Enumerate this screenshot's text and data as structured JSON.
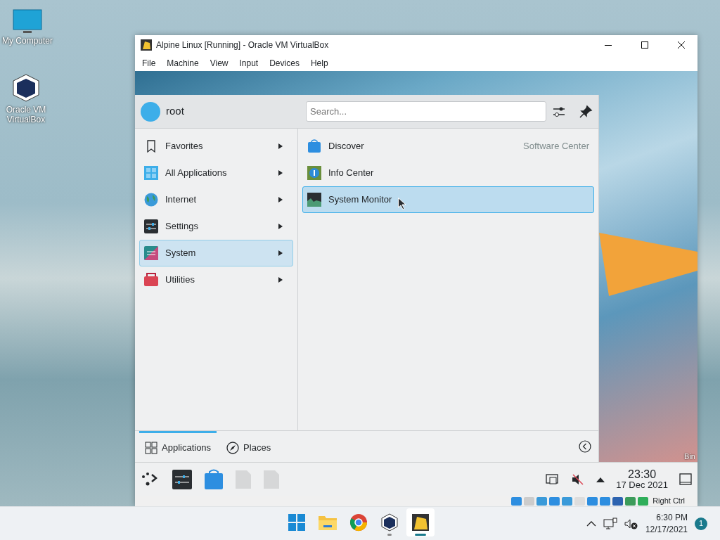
{
  "desktop_icons": [
    {
      "label": "My Computer"
    },
    {
      "label": "Oracle VM VirtualBox"
    }
  ],
  "vm_window": {
    "title": "Alpine Linux [Running] - Oracle VM VirtualBox",
    "menu": [
      "File",
      "Machine",
      "View",
      "Input",
      "Devices",
      "Help"
    ],
    "guest": {
      "launcher": {
        "user": "root",
        "search": {
          "placeholder": "Search..."
        },
        "categories": [
          {
            "label": "Favorites",
            "selected": false
          },
          {
            "label": "All Applications",
            "selected": false
          },
          {
            "label": "Internet",
            "selected": false
          },
          {
            "label": "Settings",
            "selected": false
          },
          {
            "label": "System",
            "selected": true
          },
          {
            "label": "Utilities",
            "selected": false
          }
        ],
        "apps": [
          {
            "name": "Discover",
            "description": "Software Center",
            "selected": false
          },
          {
            "name": "Info Center",
            "selected": false
          },
          {
            "name": "System Monitor",
            "selected": true
          }
        ],
        "tabs": [
          {
            "label": "Applications",
            "selected": true
          },
          {
            "label": "Places",
            "selected": false
          }
        ]
      },
      "desktop_label": "Bin",
      "panel": {
        "time": "23:30",
        "date": "17 Dec 2021"
      }
    },
    "status_bar": {
      "host_key": "Right Ctrl"
    }
  },
  "taskbar": {
    "apps": [
      {
        "running": false,
        "selected": false
      },
      {
        "running": false,
        "selected": false
      },
      {
        "running": false,
        "selected": false
      },
      {
        "running": true,
        "selected": false
      },
      {
        "running": true,
        "selected": true
      }
    ],
    "time": "6:30 PM",
    "date": "12/17/2021",
    "notification_count": "1"
  }
}
